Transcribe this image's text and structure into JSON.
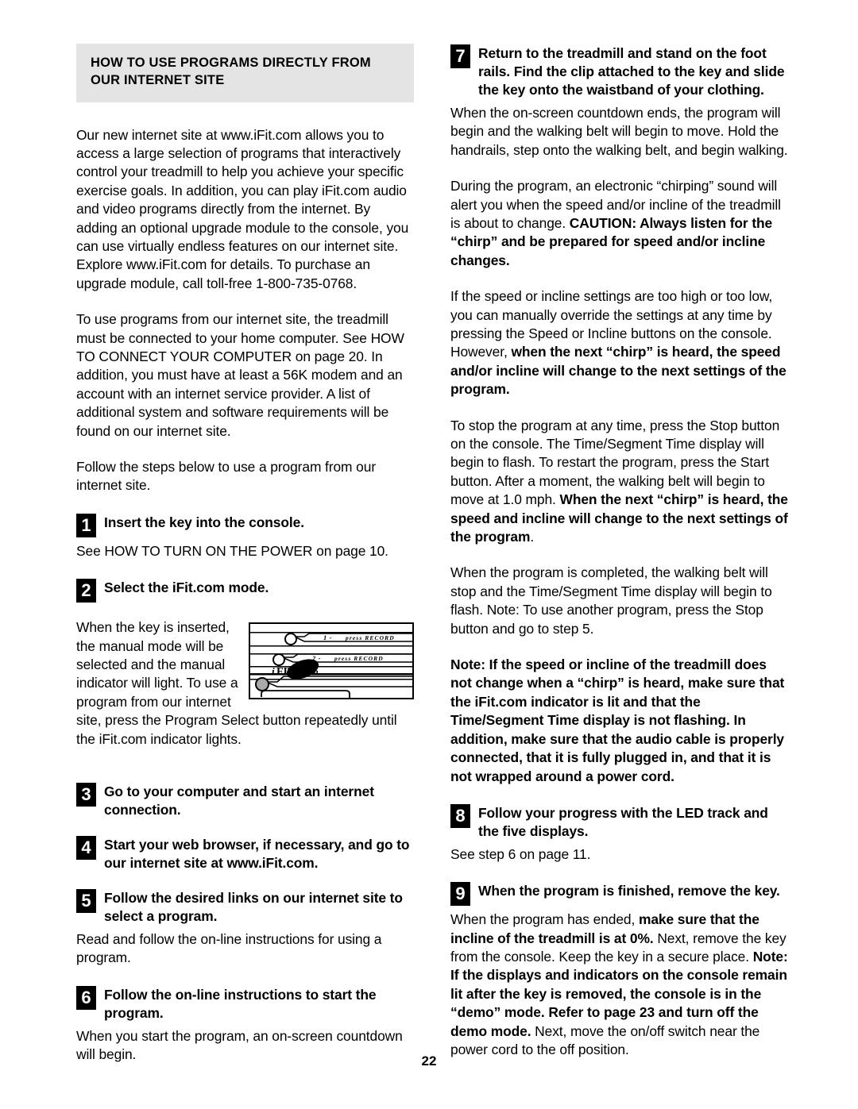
{
  "page": {
    "number": "22"
  },
  "left_column": {
    "section_title": "HOW TO USE PROGRAMS DIRECTLY FROM OUR INTERNET SITE",
    "intro_paragraph_1": "Our new internet site at www.iFit.com allows you to access a large selection of programs that interactively control your treadmill to help you achieve your specific exercise goals. In addition, you can play iFit.com audio and video programs directly from the internet. By adding an optional upgrade module to the console, you can use virtually endless features on our internet site. Explore www.iFit.com for details. To purchase an upgrade module, call toll-free 1-800-735-0768.",
    "intro_paragraph_2": "To use programs from our internet site, the treadmill must be connected to your home computer. See HOW TO CONNECT YOUR COMPUTER on page 20. In addition, you must have at least a 56K modem and an account with an internet service provider. A list of additional system and software requirements will be found on our internet site.",
    "intro_paragraph_3": "Follow the steps below to use a program from our internet site.",
    "step1": {
      "number": "1",
      "heading": "Insert the key into the console.",
      "body": "See HOW TO TURN ON THE POWER on page 10."
    },
    "step2": {
      "number": "2",
      "heading": "Select the iFit.com mode.",
      "body": "When the key is inserted, the manual mode will be selected and the manual indicator will light. To use a program from our internet site, press the Program Select button repeatedly until the iFit.com indicator lights."
    },
    "step3": {
      "number": "3",
      "heading": "Go to your computer and start an internet connection."
    },
    "step4": {
      "number": "4",
      "heading": "Start your web browser, if necessary, and go to our internet site at www.iFit.com."
    },
    "step5": {
      "number": "5",
      "heading": "Follow the desired links on our internet site to select a program.",
      "body": "Read and follow the on-line instructions for using a program."
    },
    "step6": {
      "number": "6",
      "heading": "Follow the on-line instructions to start the program.",
      "body": "When you start the program, an on-screen countdown will begin."
    },
    "figure": {
      "name": "console-ifit-indicator-diagram",
      "label_row1": "1 - press RECORD",
      "label_row2": "2 - press RECORD",
      "logo_text": "iFIT.com"
    }
  },
  "right_column": {
    "step7": {
      "number": "7",
      "heading": "Return to the treadmill and stand on the foot rails. Find the clip attached to the key and slide the key onto the waistband of your clothing.",
      "para1": "When the on-screen countdown ends, the program will begin and the walking belt will begin to move. Hold the handrails, step onto the walking belt, and begin walking.",
      "para2_normal_a": "During the program, an electronic “chirping” sound will alert you when the speed and/or incline of the treadmill is about to change. ",
      "para2_bold": "CAUTION: Always listen for the “chirp” and be prepared for speed and/or incline changes.",
      "para3_normal_a": "If the speed or incline settings are too high or too low, you can manually override the settings at any time by pressing the Speed or Incline buttons on the console. However, ",
      "para3_bold": "when the next “chirp” is heard, the speed and/or incline will change to the next settings of the program.",
      "para4_normal_a": "To stop the program at any time, press the Stop button on the console. The Time/Segment Time display will begin to flash. To restart the program, press the Start button. After a moment, the walking belt will begin to move at 1.0 mph. ",
      "para4_bold": "When the next “chirp” is heard, the speed and incline will change to the next settings of the program",
      "para4_normal_b": ".",
      "para5": "When the program is completed, the walking belt will stop and the Time/Segment Time display will begin to flash. Note: To use another program, press the Stop button and go to step 5.",
      "para6_bold": "Note: If the speed or incline of the treadmill does not change when a “chirp” is heard, make sure that the iFit.com indicator is lit and that the Time/Segment Time display is not flashing. In addition, make sure that the audio cable is properly connected, that it is fully plugged in, and that it is not wrapped around a power cord."
    },
    "step8": {
      "number": "8",
      "heading": "Follow your progress with the LED track and the five displays.",
      "body": "See step 6 on page 11."
    },
    "step9": {
      "number": "9",
      "heading": "When the program is finished, remove the key.",
      "body_normal_a": "When the program has ended, ",
      "body_bold_a": "make sure that the incline of the treadmill is at 0%.",
      "body_normal_b": " Next, remove the key from the console. Keep the key in a secure place. ",
      "body_bold_b": "Note: If the displays and indicators on the console remain lit after the key is removed, the console is in the “demo” mode. Refer to page 23 and turn off the demo mode.",
      "body_normal_c": " Next, move the on/off switch near the power cord to the off position."
    }
  }
}
